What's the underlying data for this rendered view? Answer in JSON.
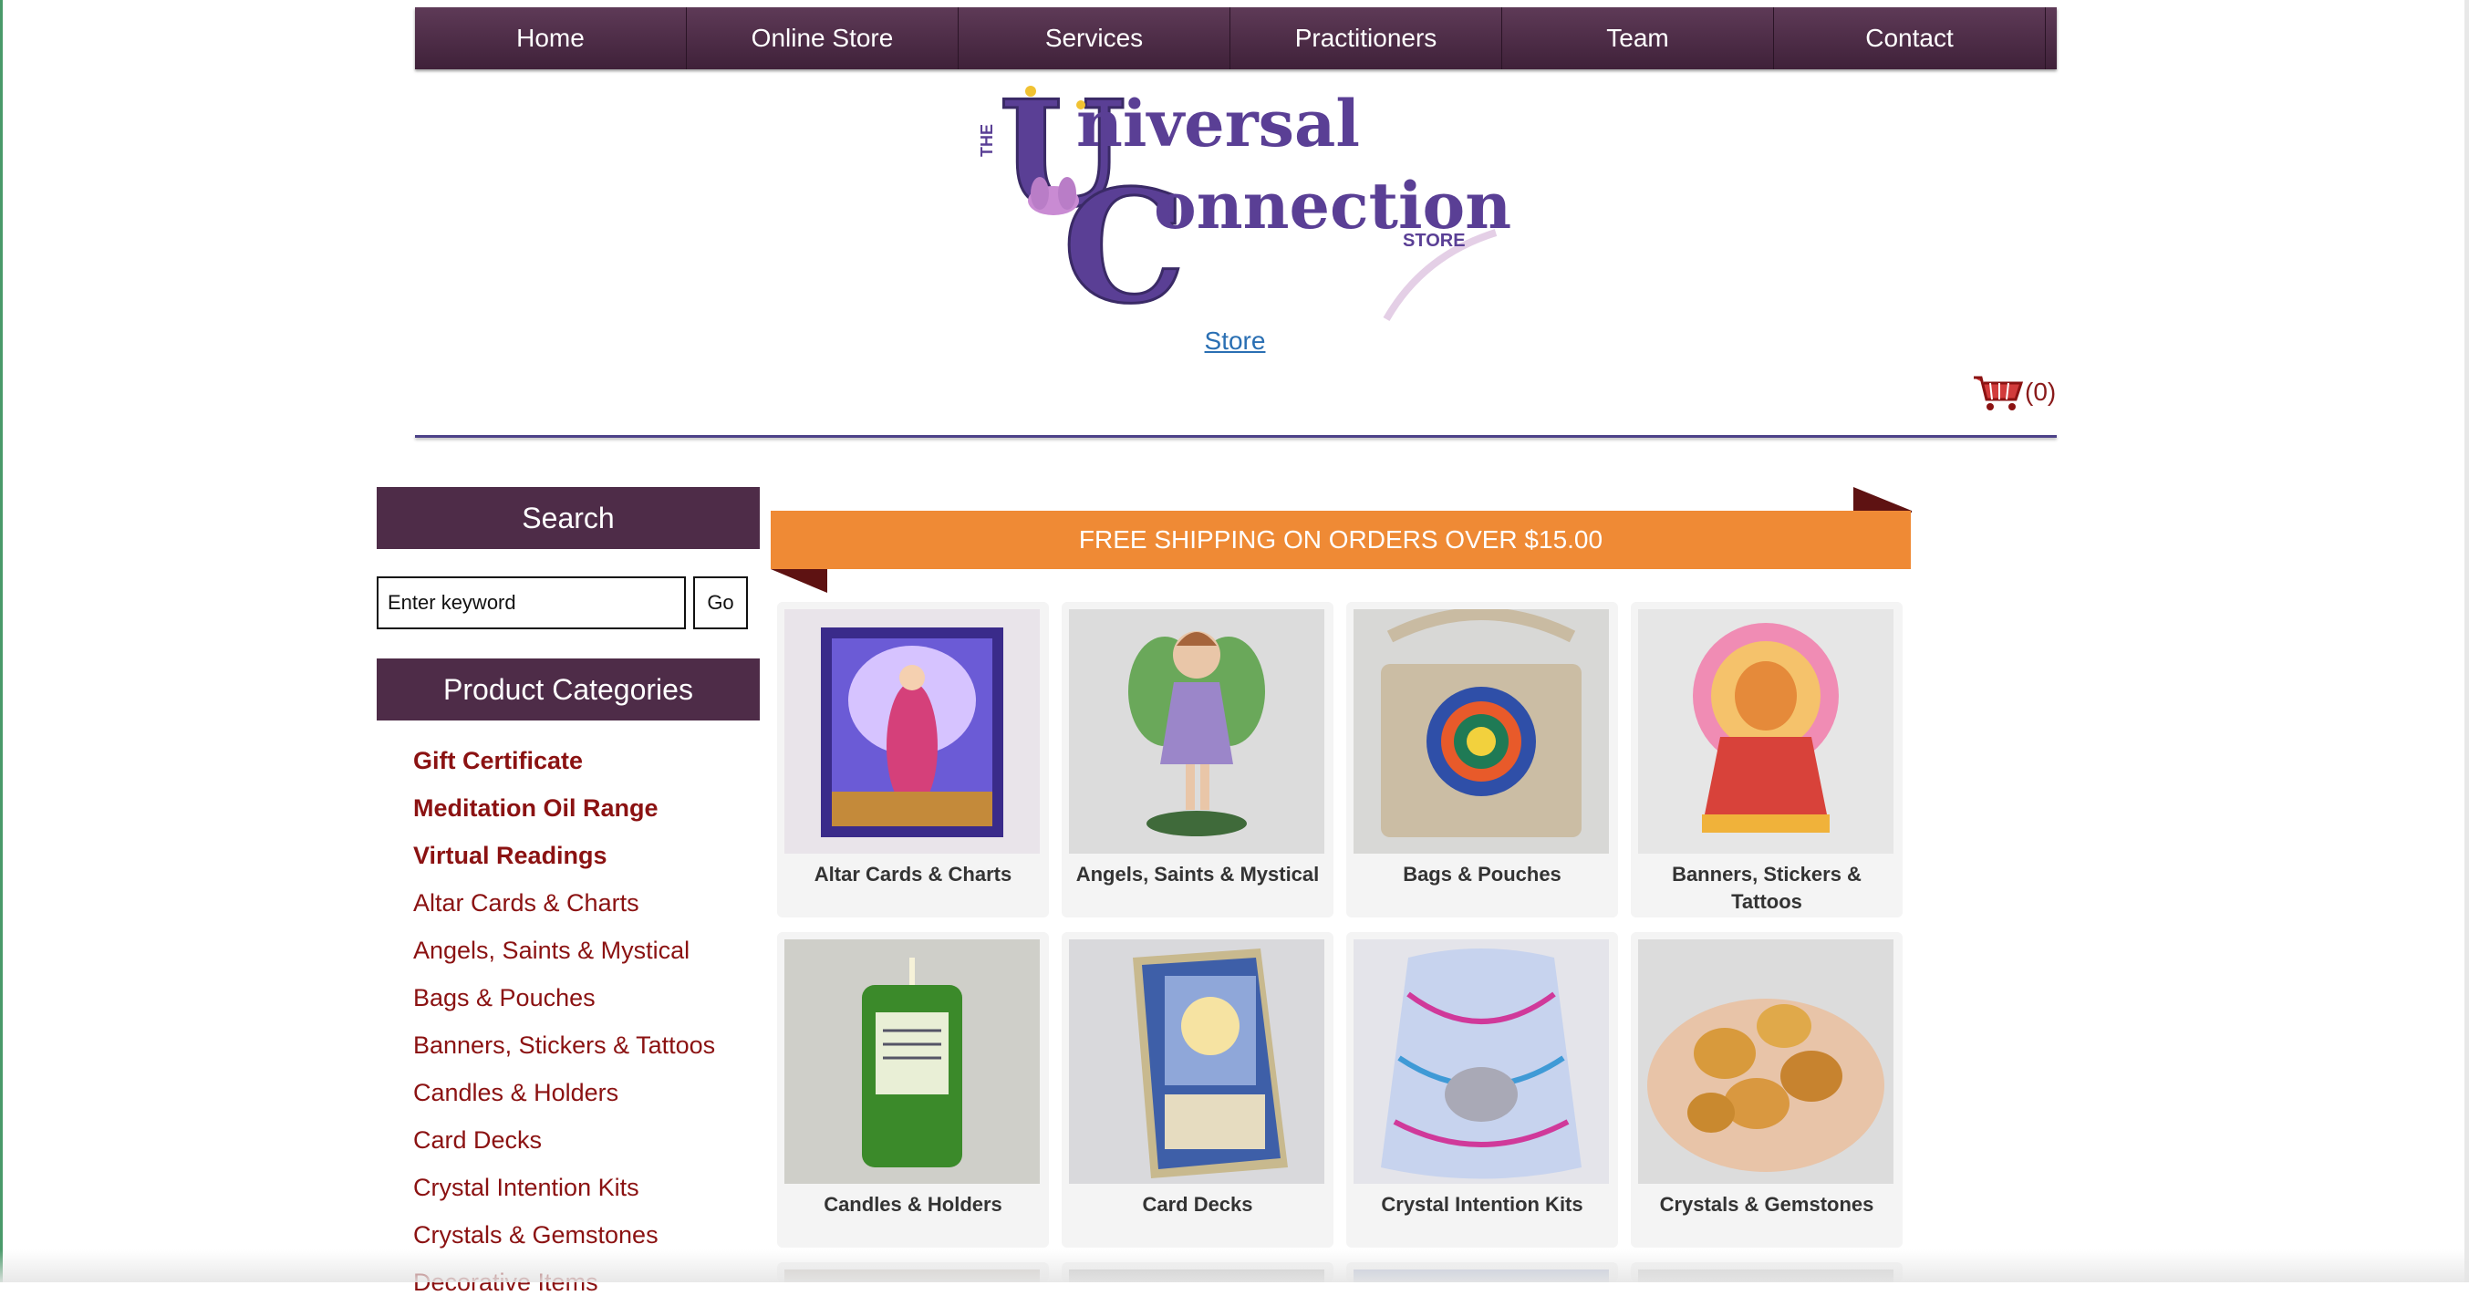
{
  "nav": {
    "items": [
      "Home",
      "Online Store",
      "Services",
      "Practitioners",
      "Team",
      "Contact"
    ]
  },
  "header": {
    "logo_prefix": "THE",
    "logo_line1": "niversal",
    "logo_line2": "onnection",
    "logo_suffix": "STORE",
    "store_link": "Store",
    "cart_count": "(0)"
  },
  "search": {
    "heading": "Search",
    "placeholder": "Enter keyword",
    "button_label": "Go"
  },
  "categories": {
    "heading": "Product Categories",
    "items": [
      {
        "label": "Gift Certificate"
      },
      {
        "label": "Meditation Oil Range"
      },
      {
        "label": "Virtual Readings"
      },
      {
        "label": "Altar Cards & Charts"
      },
      {
        "label": "Angels, Saints & Mystical"
      },
      {
        "label": "Bags & Pouches"
      },
      {
        "label": "Banners, Stickers & Tattoos"
      },
      {
        "label": "Candles & Holders"
      },
      {
        "label": "Card Decks"
      },
      {
        "label": "Crystal Intention Kits"
      },
      {
        "label": "Crystals & Gemstones"
      },
      {
        "label": "Decorative Items"
      }
    ]
  },
  "banner": {
    "text": "FREE SHIPPING ON ORDERS OVER $15.00"
  },
  "products": [
    {
      "label": "Altar Cards & Charts"
    },
    {
      "label": "Angels, Saints & Mystical"
    },
    {
      "label": "Bags & Pouches"
    },
    {
      "label": "Banners, Stickers & Tattoos"
    },
    {
      "label": "Candles & Holders"
    },
    {
      "label": "Card Decks"
    },
    {
      "label": "Crystal Intention Kits"
    },
    {
      "label": "Crystals & Gemstones"
    }
  ],
  "colors": {
    "nav_bg": "#4a2a44",
    "heading_bg": "#4e2c48",
    "category_link": "#8b1212",
    "banner_orange": "#ef8a35",
    "store_link": "#2a6fb3"
  },
  "icons": {
    "cart": "shopping-cart-icon"
  }
}
